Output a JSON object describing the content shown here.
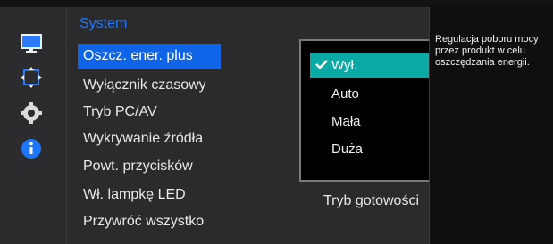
{
  "left_rail": {
    "icons": [
      "monitor-icon",
      "resize-arrows-icon",
      "gear-icon",
      "info-icon"
    ]
  },
  "main": {
    "section_title": "System",
    "menu": [
      {
        "label": "Oszcz. ener. plus",
        "selected": true
      },
      {
        "label": "Wyłącznik czasowy",
        "selected": false
      },
      {
        "label": "Tryb PC/AV",
        "selected": false
      },
      {
        "label": "Wykrywanie źródła",
        "selected": false
      },
      {
        "label": "Powt. przycisków",
        "selected": false
      },
      {
        "label": "Wł. lampkę LED",
        "selected": false
      },
      {
        "label": "Przywróć wszystko",
        "selected": false
      }
    ],
    "led_value": "Tryb gotowości"
  },
  "dropdown": {
    "options": [
      {
        "label": "Wył.",
        "selected": true
      },
      {
        "label": "Auto",
        "selected": false
      },
      {
        "label": "Mała",
        "selected": false
      },
      {
        "label": "Duża",
        "selected": false
      }
    ]
  },
  "help": {
    "text": "Regulacja poboru mocy przez produkt w celu oszczędzania energii."
  },
  "colors": {
    "accent_blue": "#0f64e8",
    "section_title_blue": "#1e76ff",
    "option_selected_teal": "#0aa9a5"
  }
}
